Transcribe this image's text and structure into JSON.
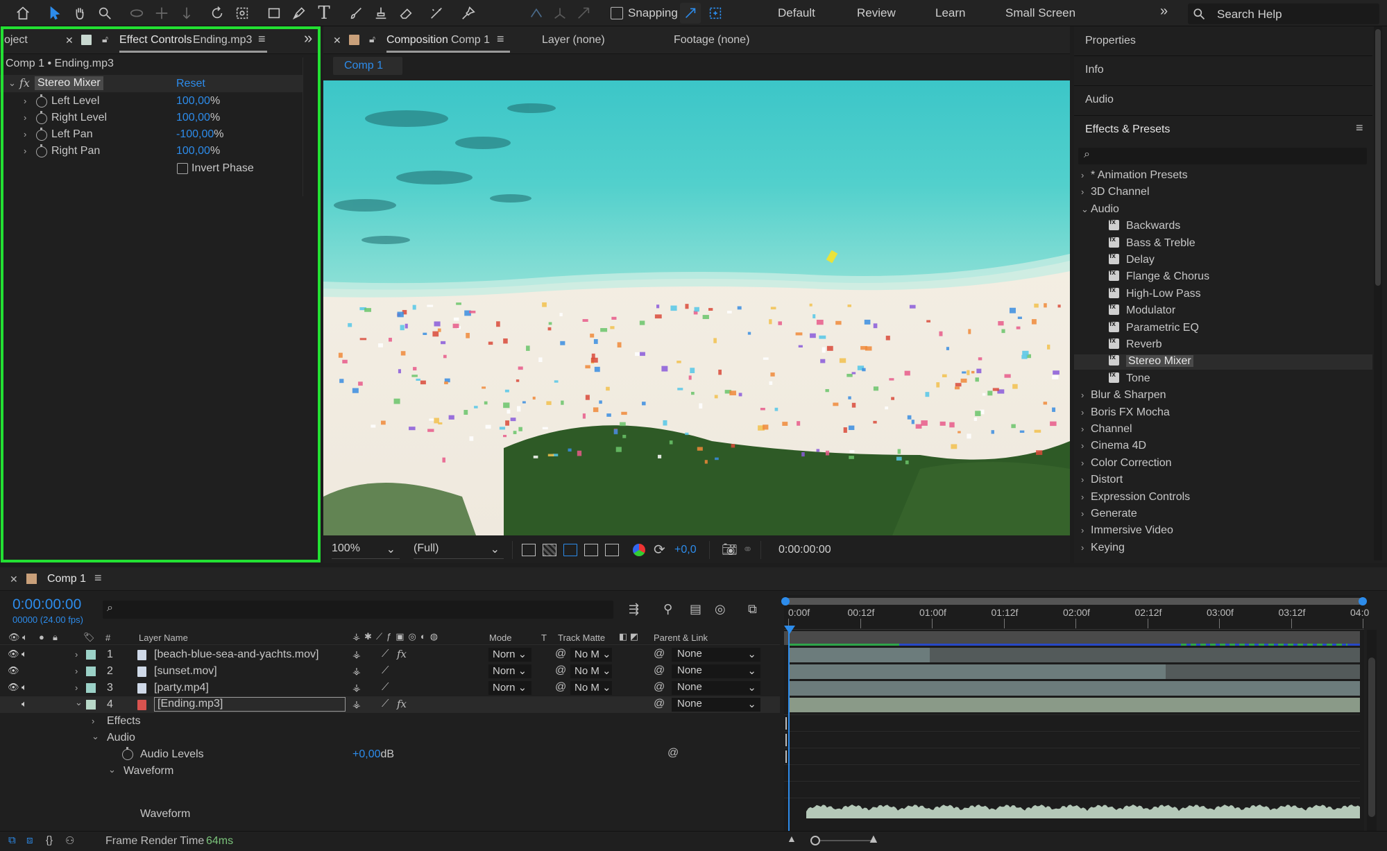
{
  "toolbar": {
    "snapping_label": "Snapping",
    "workspaces": [
      "Default",
      "Review",
      "Learn",
      "Small Screen"
    ],
    "search_placeholder": "Search Help"
  },
  "effect_controls": {
    "project_tab": "oject",
    "tab_title": "Effect Controls",
    "tab_layer": "Ending.mp3",
    "breadcrumb": "Comp 1 • Ending.mp3",
    "effect_name": "Stereo Mixer",
    "reset_label": "Reset",
    "params": [
      {
        "name": "Left Level",
        "value": "100,00",
        "unit": "%"
      },
      {
        "name": "Right Level",
        "value": "100,00",
        "unit": "%"
      },
      {
        "name": "Left Pan",
        "value": "-100,00",
        "unit": "%"
      },
      {
        "name": "Right Pan",
        "value": "100,00",
        "unit": "%"
      }
    ],
    "invert_phase_label": "Invert Phase"
  },
  "composition": {
    "tab_title": "Composition",
    "tab_comp": "Comp 1",
    "layer_tab": "Layer (none)",
    "footage_tab": "Footage (none)",
    "comp_chip": "Comp 1",
    "zoom": "100%",
    "resolution": "(Full)",
    "exposure": "+0,0",
    "timecode": "0:00:00:00"
  },
  "right_panel": {
    "properties": "Properties",
    "info": "Info",
    "audio": "Audio",
    "effects_presets": "Effects & Presets",
    "categories_top": [
      "* Animation Presets",
      "3D Channel"
    ],
    "audio_category": "Audio",
    "audio_effects": [
      "Backwards",
      "Bass & Treble",
      "Delay",
      "Flange & Chorus",
      "High-Low Pass",
      "Modulator",
      "Parametric EQ",
      "Reverb",
      "Stereo Mixer",
      "Tone"
    ],
    "categories_bottom": [
      "Blur & Sharpen",
      "Boris FX Mocha",
      "Channel",
      "Cinema 4D",
      "Color Correction",
      "Distort",
      "Expression Controls",
      "Generate",
      "Immersive Video",
      "Keying"
    ]
  },
  "timeline": {
    "tab_title": "Comp 1",
    "timecode": "0:00:00:00",
    "frames": "00000 (24.00 fps)",
    "columns": {
      "num": "#",
      "layer_name": "Layer Name",
      "mode": "Mode",
      "t": "T",
      "track_matte": "Track Matte",
      "parent": "Parent & Link"
    },
    "ruler": [
      "0:00f",
      "00:12f",
      "01:00f",
      "01:12f",
      "02:00f",
      "02:12f",
      "03:00f",
      "03:12f",
      "04:0"
    ],
    "layers": [
      {
        "num": "1",
        "name": "[beach-blue-sea-and-yachts.mov]",
        "mode": "Norn",
        "matte": "No M",
        "parent": "None",
        "color": "#9bd1c7"
      },
      {
        "num": "2",
        "name": "[sunset.mov]",
        "mode": "Norn",
        "matte": "No M",
        "parent": "None",
        "color": "#9bd1c7"
      },
      {
        "num": "3",
        "name": "[party.mp4]",
        "mode": "Norn",
        "matte": "No M",
        "parent": "None",
        "color": "#9bd1c7"
      },
      {
        "num": "4",
        "name": "[Ending.mp3]",
        "mode": "",
        "matte": "",
        "parent": "None",
        "color": "#b8d8c8"
      }
    ],
    "effects_label": "Effects",
    "audio_label": "Audio",
    "audio_levels_label": "Audio Levels",
    "audio_levels_value": "+0,00",
    "audio_levels_unit": "dB",
    "waveform_group": "Waveform",
    "waveform_label": "Waveform"
  },
  "status": {
    "frame_render_label": "Frame Render Time",
    "frame_render_value": "64ms"
  },
  "colors": {
    "accent_blue": "#2d8ceb",
    "highlight_green": "#23e033",
    "panel_bg": "#1f1f1f"
  }
}
